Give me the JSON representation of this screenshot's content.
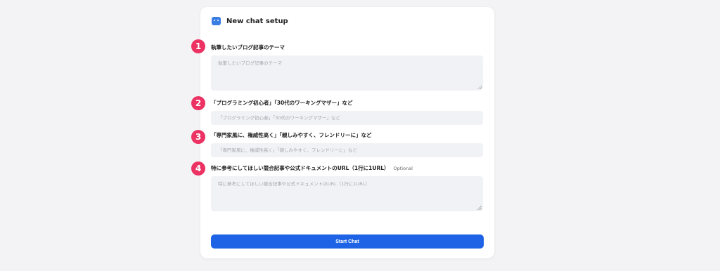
{
  "header": {
    "title": "New chat setup",
    "icon": "bot-icon"
  },
  "fields": [
    {
      "number": "1",
      "label": "執筆したいブログ記事のテーマ",
      "placeholder": "執筆したいブログ記事のテーマ",
      "optional": ""
    },
    {
      "number": "2",
      "label": "「プログラミング初心者」「30代のワーキングマザー」など",
      "placeholder": "「プログラミング初心者」「30代のワーキングマザー」など",
      "optional": ""
    },
    {
      "number": "3",
      "label": "「専門家風に、権威性高く」「親しみやすく、フレンドリーに」など",
      "placeholder": "「専門家風に、権威性高く」「親しみやすく、フレンドリーに」など",
      "optional": ""
    },
    {
      "number": "4",
      "label": "特に参考にしてほしい競合記事や公式ドキュメントのURL（1行に1URL）",
      "placeholder": "特に参考にしてほしい競合記事や公式ドキュメントのURL（1行に1URL）",
      "optional": "Optional"
    }
  ],
  "actions": {
    "start_label": "Start Chat"
  },
  "colors": {
    "accent": "#1e63e6",
    "badge": "#ec3263",
    "field_bg": "#f1f2f5"
  }
}
